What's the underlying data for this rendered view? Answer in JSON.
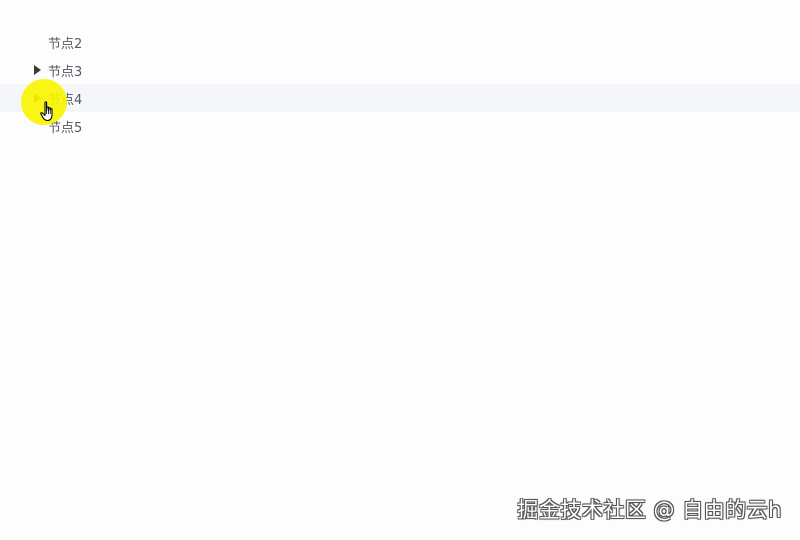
{
  "tree": {
    "nodes": [
      {
        "label": "节点2",
        "expandable": false
      },
      {
        "label": "节点3",
        "expandable": true
      },
      {
        "label": "节点4",
        "expandable": true,
        "hovered": true
      },
      {
        "label": "节点5",
        "expandable": false
      }
    ]
  },
  "cursor": {
    "icon": "hand-pointer-icon",
    "highlight_color": "#f8f400"
  },
  "watermark": {
    "text": "掘金技术社区 @ 自由的云h"
  },
  "colors": {
    "hover_row": "#f5f6fa",
    "text": "#555a61",
    "triangle": "#3a3a3a"
  }
}
